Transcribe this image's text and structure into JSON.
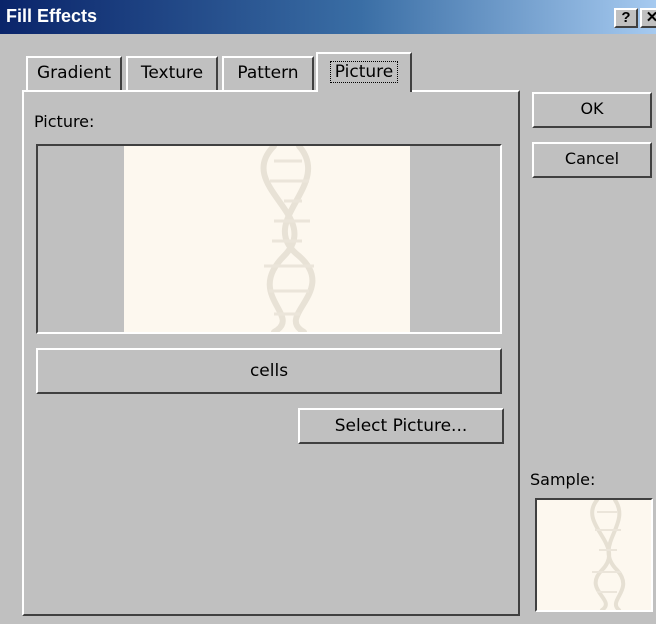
{
  "window": {
    "title": "Fill Effects",
    "help_label": "?",
    "close_label": "✕"
  },
  "tabs": [
    {
      "label": "Gradient"
    },
    {
      "label": "Texture"
    },
    {
      "label": "Pattern"
    },
    {
      "label": "Picture"
    }
  ],
  "picture": {
    "label": "Picture:",
    "name": "cells",
    "select_label": "Select Picture..."
  },
  "buttons": {
    "ok": "OK",
    "cancel": "Cancel"
  },
  "sample": {
    "label": "Sample:"
  },
  "colors": {
    "title_start": "#0a246a",
    "title_end": "#a6caf0",
    "face": "#c0c0c0",
    "picture_bg": "#fdf8ef"
  }
}
